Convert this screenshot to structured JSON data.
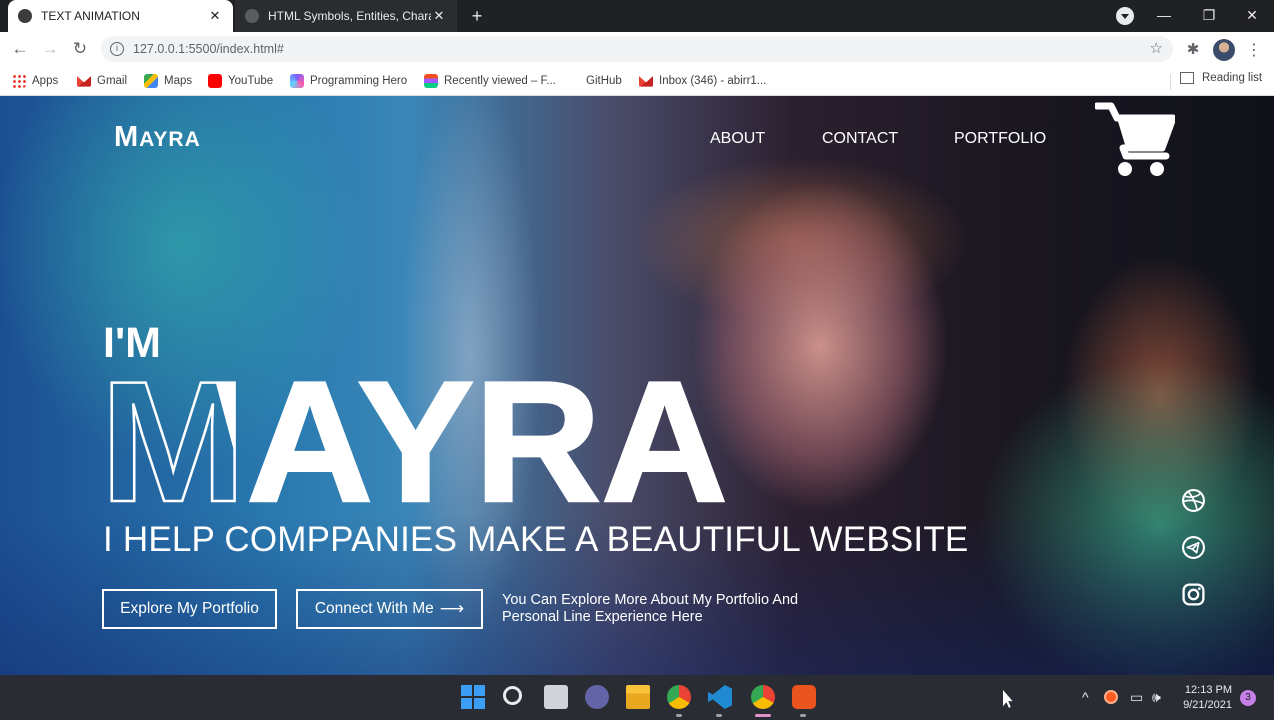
{
  "browser": {
    "tabs": [
      {
        "title": "TEXT ANIMATION",
        "close": "✕"
      },
      {
        "title": "HTML Symbols, Entities, Characte",
        "close": "✕"
      }
    ],
    "new_tab": "+",
    "window_controls": {
      "minimize": "—",
      "maximize": "❐",
      "close": "✕"
    },
    "nav": {
      "back": "←",
      "forward": "→",
      "reload": "↻"
    },
    "address": {
      "info": "i",
      "url": "127.0.0.1:5500/index.html#",
      "star": "☆"
    },
    "toolbar_icons": {
      "extensions": "✱",
      "menu": "⋮"
    },
    "bookmarks": [
      {
        "label": "Apps",
        "icon": "apps-icon"
      },
      {
        "label": "Gmail",
        "icon": "gmail-icon"
      },
      {
        "label": "Maps",
        "icon": "maps-icon"
      },
      {
        "label": "YouTube",
        "icon": "youtube-icon"
      },
      {
        "label": "Programming Hero",
        "icon": "programming-hero-icon"
      },
      {
        "label": "Recently viewed – F...",
        "icon": "figma-icon"
      },
      {
        "label": "GitHub",
        "icon": "github-icon"
      },
      {
        "label": "Inbox (346) - abirr1...",
        "icon": "gmail-icon"
      }
    ],
    "reading_list": "Reading list"
  },
  "page": {
    "logo": {
      "first": "M",
      "rest": "AYRA"
    },
    "nav_links": [
      "ABOUT",
      "CONTACT",
      "PORTFOLIO"
    ],
    "hero": {
      "intro": "I'M",
      "name": "MAYRA",
      "tagline": "I HELP COMPPANIES MAKE A BEAUTIFUL WEBSITE",
      "btn_primary": "Explore My Portfolio",
      "btn_secondary": "Connect With Me",
      "btn_secondary_arrow": "⟶",
      "note": "You Can Explore More About My Portfolio And Personal Line Experience Here"
    },
    "social_icons": [
      "dribbble-icon",
      "telegram-icon",
      "instagram-icon"
    ],
    "colors": {
      "text": "#ffffff",
      "chrome_dark": "#202124"
    }
  },
  "taskbar": {
    "clock_time": "12:13 PM",
    "clock_date": "9/21/2021",
    "notification_count": "3",
    "tray": {
      "chevron": "^",
      "volume": "🕪",
      "network": "▭"
    }
  }
}
